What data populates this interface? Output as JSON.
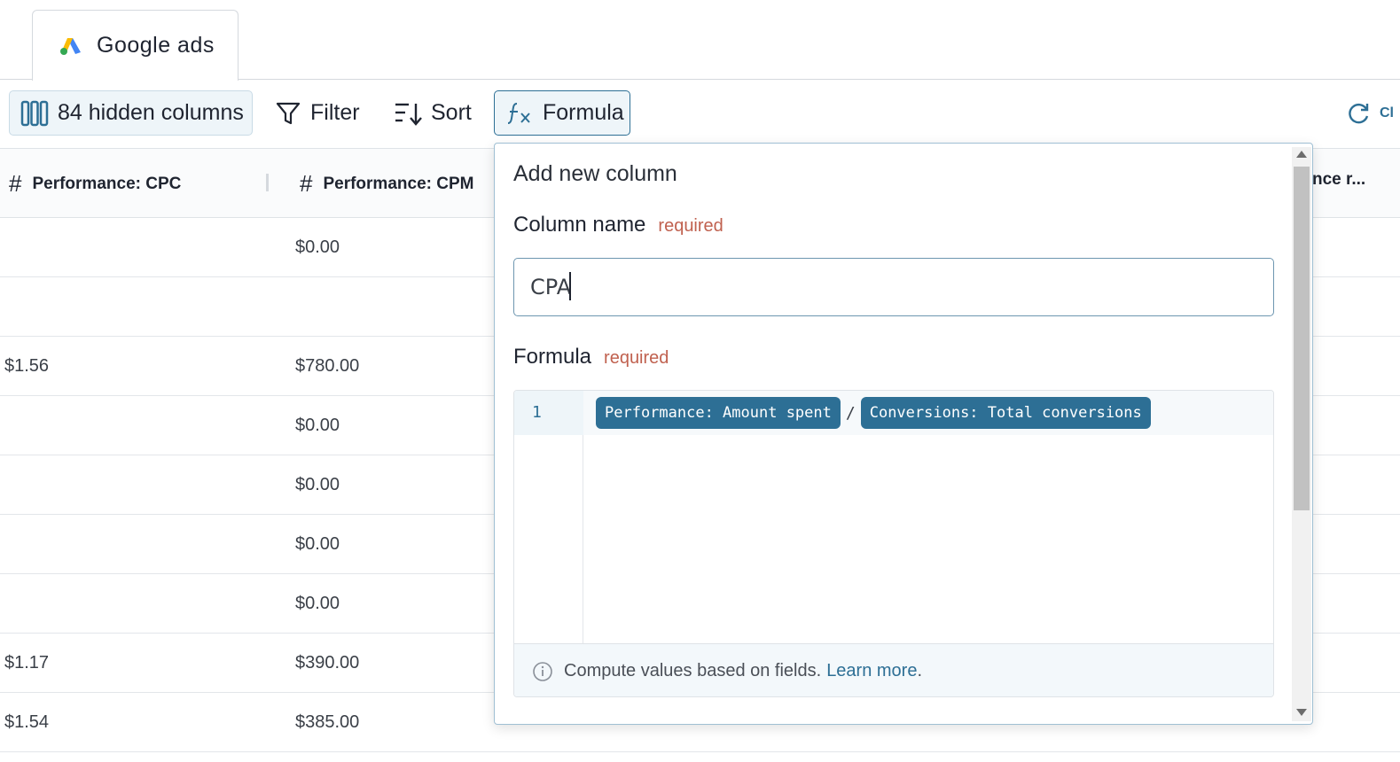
{
  "tab": {
    "label": "Google ads",
    "icon": "google-ads-logo"
  },
  "toolbar": {
    "hidden_columns": "84 hidden columns",
    "filter": "Filter",
    "sort": "Sort",
    "formula": "Formula",
    "refresh_partial": "Cl"
  },
  "table": {
    "columns": [
      {
        "hash": "#",
        "label": "Performance: CPC"
      },
      {
        "hash": "#",
        "label": "Performance: CPM"
      },
      {
        "label": "nce r..."
      }
    ],
    "rows": [
      {
        "cpc": "",
        "cpm": "$0.00"
      },
      {
        "cpc": "",
        "cpm": ""
      },
      {
        "cpc": "$1.56",
        "cpm": "$780.00"
      },
      {
        "cpc": "",
        "cpm": "$0.00"
      },
      {
        "cpc": "",
        "cpm": "$0.00"
      },
      {
        "cpc": "",
        "cpm": "$0.00"
      },
      {
        "cpc": "",
        "cpm": "$0.00"
      },
      {
        "cpc": "$1.17",
        "cpm": "$390.00"
      },
      {
        "cpc": "$1.54",
        "cpm": "$385.00"
      }
    ]
  },
  "popover": {
    "title": "Add new column",
    "column_name_label": "Column name",
    "column_name_required": "required",
    "column_name_value": "CPA",
    "formula_label": "Formula",
    "formula_required": "required",
    "line_number": "1",
    "chip_left": "Performance: Amount spent",
    "operator": "/",
    "chip_right": "Conversions: Total conversions",
    "hint_text": "Compute values based on fields.",
    "hint_link": "Learn more",
    "hint_end": "."
  },
  "colors": {
    "accent": "#2d6f95",
    "required": "#c0614f",
    "chip_bg": "#2d6f95"
  }
}
